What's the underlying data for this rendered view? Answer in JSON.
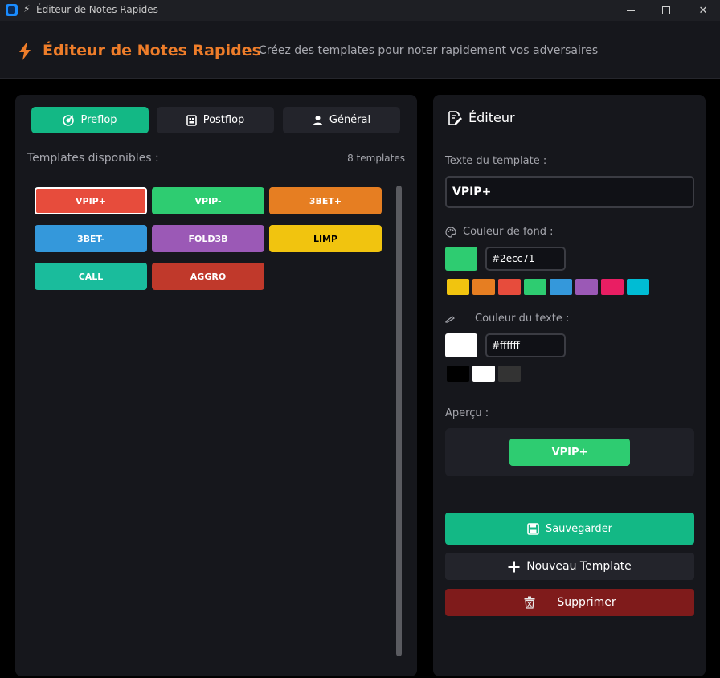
{
  "window": {
    "title": "Éditeur de Notes Rapides"
  },
  "header": {
    "title": "Éditeur de Notes Rapides",
    "subtitle": "Créez des templates pour noter rapidement vos adversaires",
    "accent_color": "#ee7d2a"
  },
  "tabs": [
    {
      "label": "Preflop",
      "icon": "target-icon",
      "active": true
    },
    {
      "label": "Postflop",
      "icon": "board-icon",
      "active": false
    },
    {
      "label": "Général",
      "icon": "user-icon",
      "active": false
    }
  ],
  "templates_panel": {
    "heading": "Templates disponibles :",
    "count": "8 templates",
    "items": [
      {
        "label": "VPIP+",
        "bg": "#e74c3c",
        "fg": "#ffffff",
        "selected": true
      },
      {
        "label": "VPIP-",
        "bg": "#2ecc71",
        "fg": "#ffffff",
        "selected": false
      },
      {
        "label": "3BET+",
        "bg": "#e67e22",
        "fg": "#ffffff",
        "selected": false
      },
      {
        "label": "3BET-",
        "bg": "#3498db",
        "fg": "#ffffff",
        "selected": false
      },
      {
        "label": "FOLD3B",
        "bg": "#9b59b6",
        "fg": "#ffffff",
        "selected": false
      },
      {
        "label": "LIMP",
        "bg": "#f1c40f",
        "fg": "#000000",
        "selected": false
      },
      {
        "label": "CALL",
        "bg": "#1abc9c",
        "fg": "#ffffff",
        "selected": false
      },
      {
        "label": "AGGRO",
        "bg": "#c0392b",
        "fg": "#ffffff",
        "selected": false
      }
    ]
  },
  "editor": {
    "title": "Éditeur",
    "text_label": "Texte du template :",
    "text_value": "VPIP+",
    "bg_label": "Couleur de fond :",
    "bg_value": "#2ecc71",
    "bg_swatches": [
      "#f1c40f",
      "#e67e22",
      "#e74c3c",
      "#2ecc71",
      "#3498db",
      "#9b59b6",
      "#e91e63",
      "#00bcd4"
    ],
    "fg_label": "Couleur du texte :",
    "fg_value": "#ffffff",
    "fg_swatches": [
      "#000000",
      "#ffffff",
      "#333333"
    ],
    "preview_label": "Aperçu :",
    "preview_text": "VPIP+",
    "save_label": "Sauvegarder",
    "new_label": "Nouveau Template",
    "delete_label": "Supprimer"
  }
}
